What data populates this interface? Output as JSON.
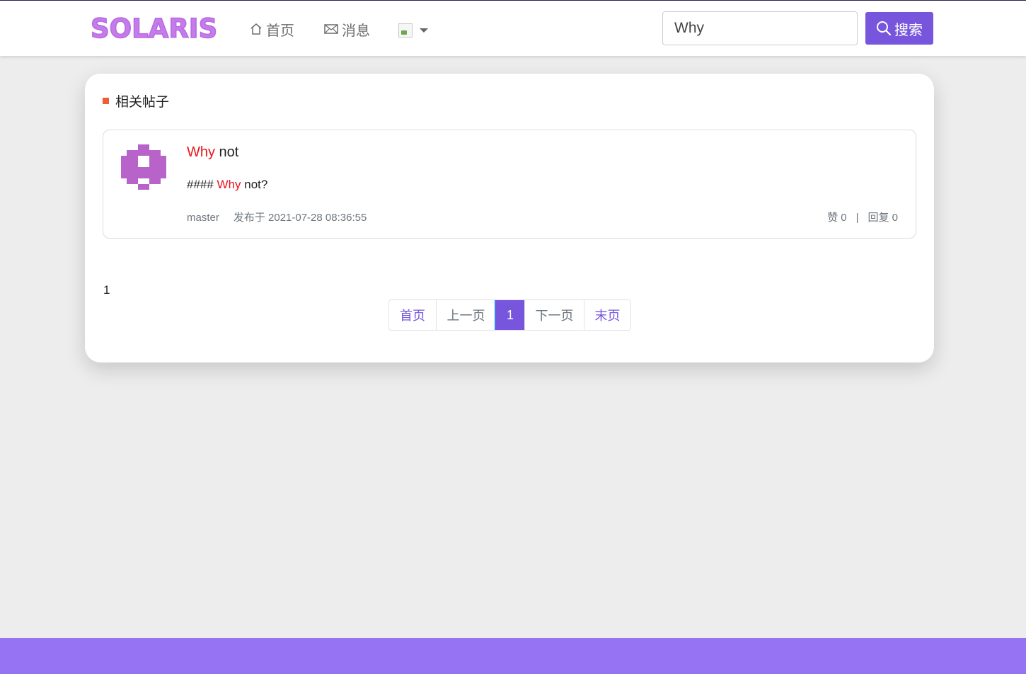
{
  "brand": {
    "logo_text": "SOLARIS",
    "logo_color": "#c47ce8"
  },
  "nav": {
    "home_label": "首页",
    "messages_label": "消息",
    "user_menu_icon": "broken-image-icon"
  },
  "search": {
    "value": "Why",
    "button_label": "搜索",
    "button_color": "#7755dd"
  },
  "section": {
    "title": "相关帖子",
    "marker_color": "#f25a38"
  },
  "posts": [
    {
      "title_highlight": "Why",
      "title_rest": " not",
      "body_prefix": "#### ",
      "body_highlight": "Why",
      "body_rest": " not?",
      "author": "master",
      "published": "发布于 2021-07-28 08:36:55",
      "likes": "赞 0",
      "separator": "|",
      "replies": "回复 0",
      "highlight_color": "#e8141b"
    }
  ],
  "pagination": {
    "page_label": "1",
    "first": "首页",
    "prev": "上一页",
    "current": "1",
    "next": "下一页",
    "last": "末页"
  },
  "footer_color": "#9673f3"
}
